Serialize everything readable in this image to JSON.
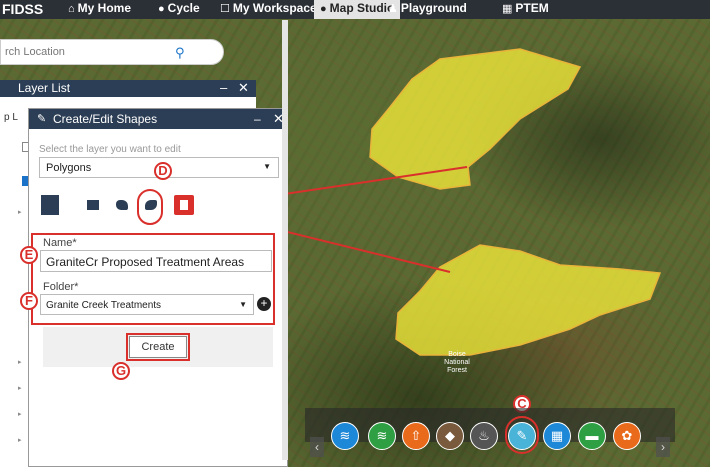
{
  "topnav": {
    "logo": "FIDSS",
    "items": [
      {
        "label": "My Home",
        "icon": "home-icon",
        "glyph": "⌂"
      },
      {
        "label": "Cycle",
        "icon": "cycle-icon",
        "glyph": "●"
      },
      {
        "label": "My Workspace",
        "icon": "workspace-icon",
        "glyph": "☐"
      },
      {
        "label": "Map Studio",
        "icon": "globe-icon",
        "glyph": "●",
        "active": true
      },
      {
        "label": "Playground",
        "icon": "playground-icon",
        "glyph": "♟"
      },
      {
        "label": "PTEM",
        "icon": "ptem-icon",
        "glyph": "▦"
      }
    ]
  },
  "search": {
    "placeholder": "rch Location",
    "icon": "search-icon"
  },
  "layer_list": {
    "title": "Layer List",
    "minimize": "–",
    "close": "✕",
    "partial_label": "p L"
  },
  "create_edit": {
    "title": "Create/Edit Shapes",
    "minimize": "–",
    "close": "✕",
    "subtitle": "Select the layer you want to edit",
    "layer_value": "Polygons",
    "name_label": "Name*",
    "name_value": "GraniteCr Proposed Treatment Areas",
    "folder_label": "Folder*",
    "folder_value": "Granite Creek Treatments",
    "create_label": "Create"
  },
  "annotations": {
    "C": "C",
    "D": "D",
    "E": "E",
    "F": "F",
    "G": "G"
  },
  "map_label": {
    "line1": "Boise",
    "line2": "National",
    "line3": "Forest"
  },
  "toolbar": [
    {
      "icon": "layers-icon",
      "color": "#1e88d8"
    },
    {
      "icon": "basemap-icon",
      "color": "#2ea043"
    },
    {
      "icon": "upload-icon",
      "color": "#e86a1a"
    },
    {
      "icon": "analysis-icon",
      "color": "#7a5a3c"
    },
    {
      "icon": "fire-icon",
      "color": "#555555"
    },
    {
      "icon": "draw-shapes-icon",
      "color": "#4ab3d8"
    },
    {
      "icon": "grid-icon",
      "color": "#1e88d8"
    },
    {
      "icon": "measure-icon",
      "color": "#2ea043"
    },
    {
      "icon": "palette-icon",
      "color": "#e86a1a"
    }
  ],
  "colors": {
    "panel_header": "#2c3e55",
    "annotation_red": "#d9302c",
    "polygon_fill": "#f2ea3a"
  }
}
